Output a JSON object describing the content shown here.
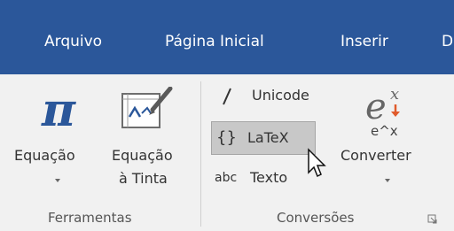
{
  "tabs": {
    "arquivo": "Arquivo",
    "pagina_inicial": "Página Inicial",
    "inserir": "Inserir",
    "partial": "D"
  },
  "ferramentas": {
    "equacao_label": "Equação",
    "equacao_tinta_line1": "Equação",
    "equacao_tinta_line2": "à Tinta",
    "group_label": "Ferramentas"
  },
  "conversoes": {
    "unicode_label": "Unicode",
    "latex_label": "LaTeX",
    "latex_icon": "{}",
    "texto_label": "Texto",
    "texto_icon": "abc",
    "converter_label": "Converter",
    "converter_icon_bottom": "e^x",
    "group_label": "Conversões"
  },
  "colors": {
    "title_bar": "#2b579a",
    "ribbon_bg": "#f1f1f1",
    "accent_blue": "#2b579a",
    "selected_bg": "#c8c8c8"
  }
}
